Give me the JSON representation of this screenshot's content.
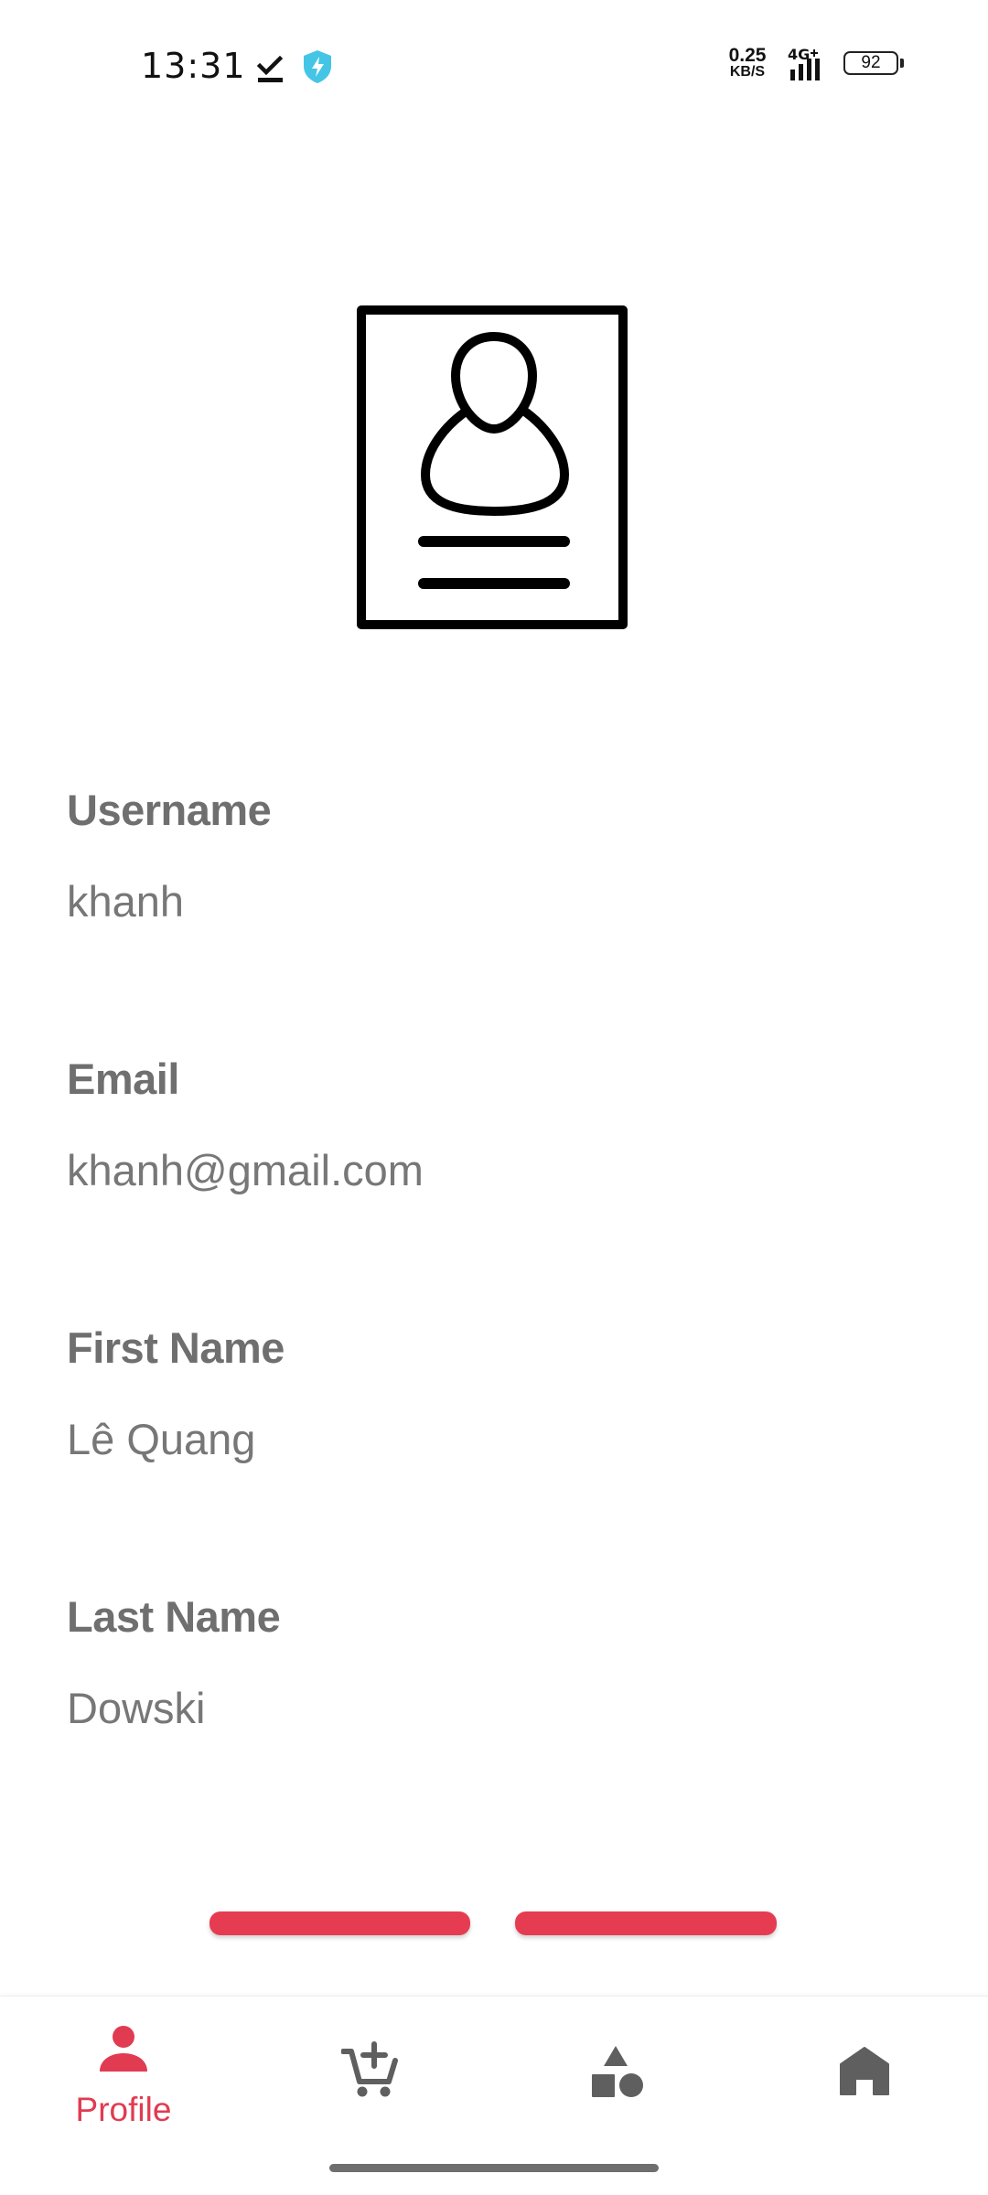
{
  "status_bar": {
    "time": "13:31",
    "net_speed_value": "0.25",
    "net_speed_unit": "KB/S",
    "network_type": "4G",
    "battery_level": "92",
    "icons": [
      "download-done-icon",
      "shield-bolt-icon",
      "signal-icon",
      "battery-icon"
    ]
  },
  "profile": {
    "illustration_icon": "profile-card-icon",
    "fields": [
      {
        "label": "Username",
        "value": "khanh"
      },
      {
        "label": "Email",
        "value": "khanh@gmail.com"
      },
      {
        "label": "First Name",
        "value": "Lê Quang"
      },
      {
        "label": "Last Name",
        "value": "Dowski"
      }
    ]
  },
  "actions": {
    "color": "#e63c52",
    "buttons": [
      {
        "name": "left-action-button",
        "label": ""
      },
      {
        "name": "right-action-button",
        "label": ""
      }
    ]
  },
  "bottom_nav": {
    "active_color": "#e13b51",
    "inactive_color": "#5f5f5f",
    "items": [
      {
        "icon": "person-icon",
        "label": "Profile",
        "active": true
      },
      {
        "icon": "add-to-cart-icon",
        "label": "",
        "active": false
      },
      {
        "icon": "category-shapes-icon",
        "label": "",
        "active": false
      },
      {
        "icon": "home-icon",
        "label": "",
        "active": false
      }
    ]
  }
}
